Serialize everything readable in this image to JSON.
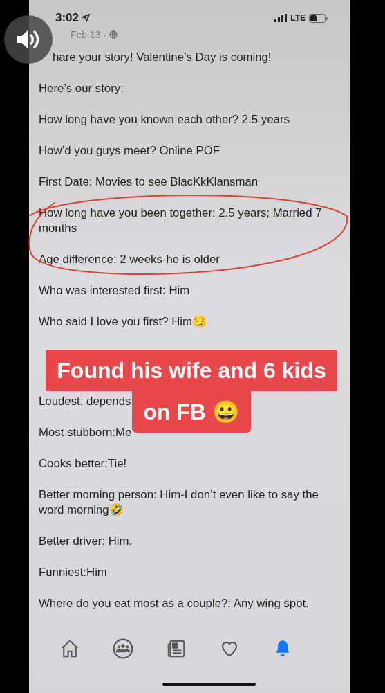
{
  "status_bar": {
    "time": "3:02",
    "network": "LTE"
  },
  "post": {
    "date": "Feb 13 ·",
    "lines": [
      {
        "text": "hare your story! Valentine’s Day is coming!"
      },
      {
        "text": "Here’s our story:"
      },
      {
        "text": "How long have you known each other? 2.5 years"
      },
      {
        "text": "How’d you guys meet? Online POF"
      },
      {
        "text": "First Date: Movies to see BlacKkKlansman"
      },
      {
        "text": "How long have you been together: 2.5 years; Married 7 months"
      },
      {
        "text": "Age difference: 2 weeks-he is older"
      },
      {
        "text": "Who was interested first: Him"
      },
      {
        "text": "Who said I love you first? Him😏"
      },
      {
        "text": "Loudest: depends"
      },
      {
        "text": "Most stubborn:Me"
      },
      {
        "text": "Cooks better:Tie!"
      },
      {
        "text": "Better morning person: Him-I don’t even like to say the word morning🤣"
      },
      {
        "text": "Better driver: Him."
      },
      {
        "text": "Funniest:Him"
      },
      {
        "text": "Where do you eat most as a couple?: Any wing spot."
      }
    ]
  },
  "caption": [
    "Found his wife and 6 kids",
    "on FB 😀"
  ],
  "nav": [
    {
      "kind": "home",
      "selected": false
    },
    {
      "kind": "groups",
      "selected": false
    },
    {
      "kind": "news",
      "selected": false
    },
    {
      "kind": "dating",
      "selected": false
    },
    {
      "kind": "bell",
      "selected": true
    }
  ]
}
